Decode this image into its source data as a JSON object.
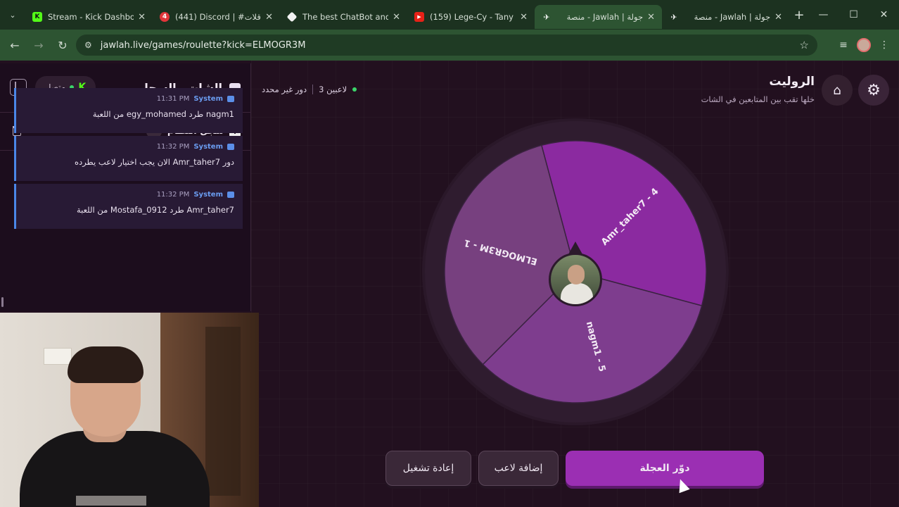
{
  "browser": {
    "tabs": [
      {
        "title": "Stream - Kick Dashbo",
        "favicon": "kick",
        "active": false
      },
      {
        "title": "(441) Discord | #قلات",
        "favicon": "discord",
        "active": false
      },
      {
        "title": "The best ChatBot and",
        "favicon": "chatbot",
        "active": false
      },
      {
        "title": "(159) Lege-Cy - Tany",
        "favicon": "youtube",
        "active": false
      },
      {
        "title": "جولة | Jawlah - منصة",
        "favicon": "jawlah",
        "active": true
      },
      {
        "title": "جولة | Jawlah - منصة",
        "favicon": "jawlah",
        "active": false
      }
    ],
    "url": "jawlah.live/games/roulette?kick=ELMOGR3M"
  },
  "chat_panel": {
    "title": "الشات والسجل",
    "status_label": "متصل",
    "system_log_title": "سجل النظام",
    "log_count": "76",
    "messages": [
      {
        "sender": "System",
        "time": "11:31 PM",
        "text": "nagm1 طرد egy_mohamed من اللعبة"
      },
      {
        "sender": "System",
        "time": "11:32 PM",
        "text": "دور Amr_taher7 الان يجب اختيار لاعب يطرده"
      },
      {
        "sender": "System",
        "time": "11:32 PM",
        "text": "Amr_taher7 طرد Mostafa_0912 من اللعبة"
      }
    ]
  },
  "game": {
    "title": "الروليت",
    "subtitle": "خلها تقب بين المتابعين في الشات",
    "players_label": "3 لاعبين",
    "turn_label": "دور غير محدد"
  },
  "wheel": {
    "segments": [
      {
        "label": "Amr_taher7 - 4",
        "color": "#8b2aa0"
      },
      {
        "label": "nagm1 - 5",
        "color": "#7e3d8e"
      },
      {
        "label": "ELMOGR3M - 1",
        "color": "#77407f"
      }
    ]
  },
  "buttons": {
    "spin": "دوّر العجلة",
    "add_player": "إضافة لاعب",
    "reset": "إعادة تشغيل"
  },
  "colors": {
    "accent": "#9b2fb3",
    "background": "#22101f",
    "online": "#3bd46a"
  }
}
